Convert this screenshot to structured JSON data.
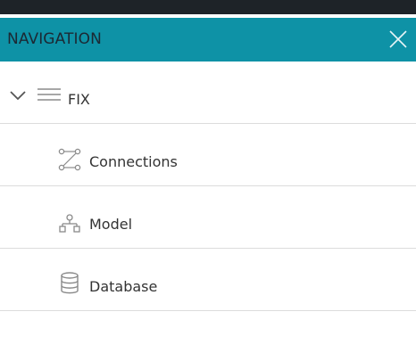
{
  "header": {
    "title": "NAVIGATION",
    "close_icon": "close-icon"
  },
  "tree": {
    "root": {
      "label": "FIX",
      "expand_icon": "chevron-down-icon",
      "type_icon": "hamburger-icon"
    },
    "children": [
      {
        "label": "Connections",
        "icon": "connections-icon"
      },
      {
        "label": "Model",
        "icon": "hierarchy-icon"
      },
      {
        "label": "Database",
        "icon": "database-icon"
      }
    ]
  },
  "colors": {
    "header_bg": "#0e92a6",
    "topbar_bg": "#1e2328",
    "divider": "#dcdcdc",
    "icon_gray": "#8a8a8a"
  }
}
